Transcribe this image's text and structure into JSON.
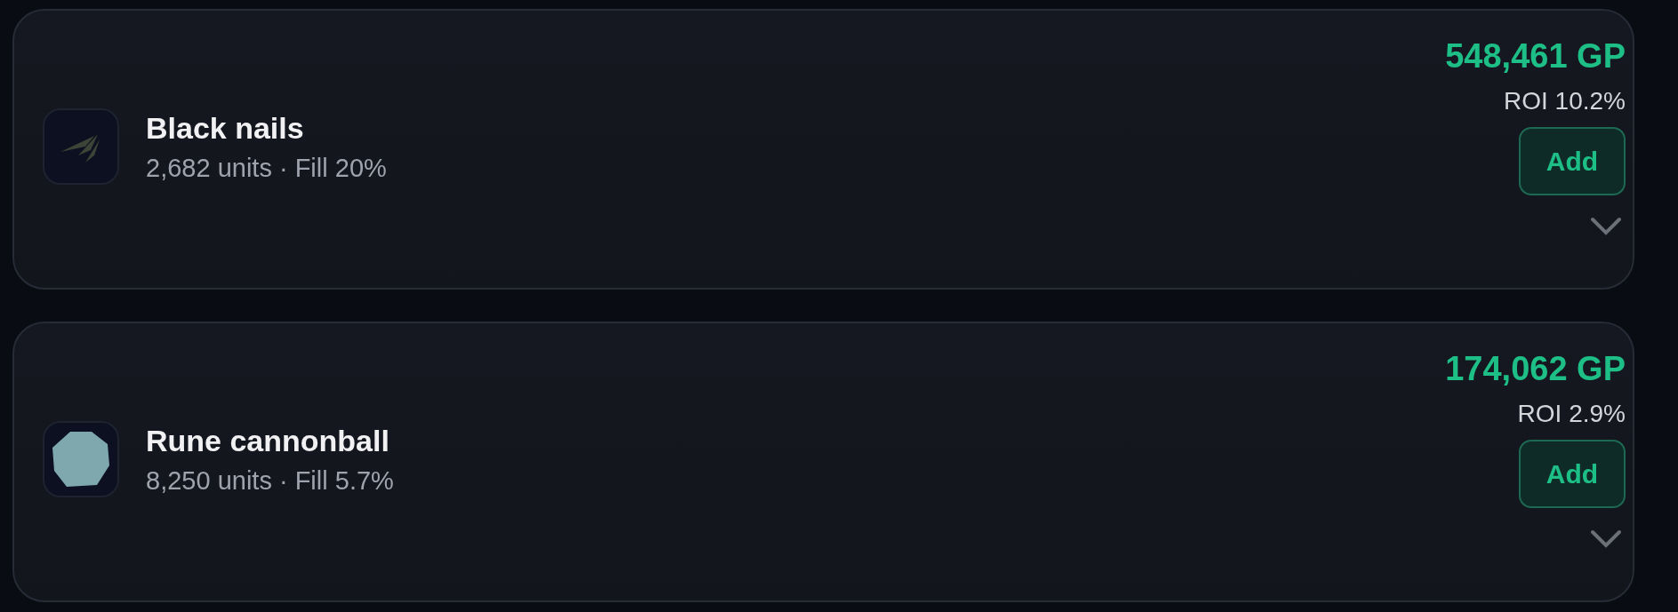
{
  "items": [
    {
      "kind": "nails",
      "name": "Black nails",
      "details": "2,682 units · Fill 20%",
      "profit": "548,461 GP",
      "roi": "ROI 10.2%",
      "button": "Add"
    },
    {
      "kind": "cannonball",
      "name": "Rune cannonball",
      "details": "8,250 units · Fill 5.7%",
      "profit": "174,062 GP",
      "roi": "ROI 2.9%",
      "button": "Add"
    }
  ]
}
